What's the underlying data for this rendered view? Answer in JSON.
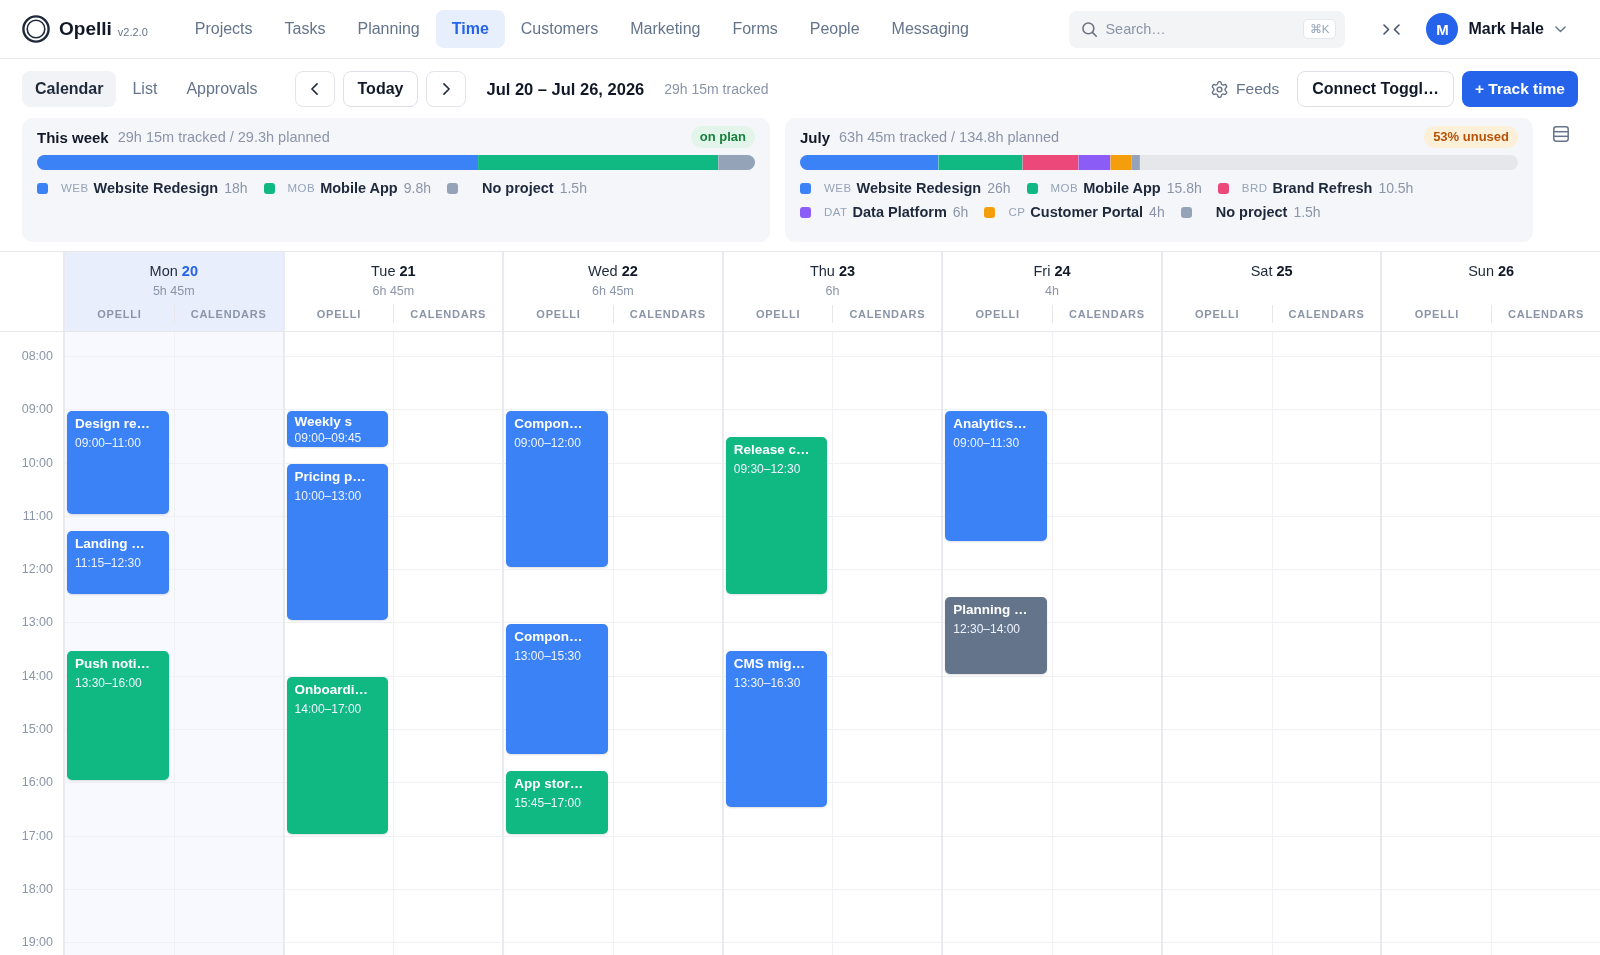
{
  "app": {
    "name": "Opelli",
    "version": "v2.2.0"
  },
  "nav": [
    {
      "label": "Projects",
      "selected": false
    },
    {
      "label": "Tasks",
      "selected": false
    },
    {
      "label": "Planning",
      "selected": false
    },
    {
      "label": "Time",
      "selected": true
    },
    {
      "label": "Customers",
      "selected": false
    },
    {
      "label": "Marketing",
      "selected": false
    },
    {
      "label": "Forms",
      "selected": false
    },
    {
      "label": "People",
      "selected": false
    },
    {
      "label": "Messaging",
      "selected": false
    }
  ],
  "search": {
    "placeholder": "Search…",
    "shortcut": "⌘K"
  },
  "user": {
    "initial": "M",
    "name": "Mark Hale"
  },
  "view_tabs": [
    {
      "label": "Calendar",
      "selected": true
    },
    {
      "label": "List",
      "selected": false
    },
    {
      "label": "Approvals",
      "selected": false
    }
  ],
  "toolbar": {
    "today_button": "Today",
    "date_range": "Jul 20 – Jul 26, 2026",
    "tracked": "29h 15m tracked",
    "feeds_button": "Feeds",
    "connect_button": "Connect Toggl…",
    "track_button": "+ Track time"
  },
  "summaries": [
    {
      "title": "This week",
      "stats": "29h 15m tracked / 29.3h planned",
      "badge": {
        "text": "on plan",
        "kind": "success"
      },
      "projects": [
        {
          "code": "WEB",
          "name": "Website Redesign",
          "hours": "18h",
          "color": "#3b82f6"
        },
        {
          "code": "MOB",
          "name": "Mobile App",
          "hours": "9.8h",
          "color": "#10b981"
        },
        {
          "name": "No project",
          "hours": "1.5h",
          "color": "#94a3b8"
        }
      ]
    },
    {
      "title": "July",
      "stats": "63h 45m tracked / 134.8h planned",
      "badge": {
        "text": "53% unused",
        "kind": "warning"
      },
      "projects": [
        {
          "code": "WEB",
          "name": "Website Redesign",
          "hours": "26h",
          "color": "#3b82f6"
        },
        {
          "code": "MOB",
          "name": "Mobile App",
          "hours": "15.8h",
          "color": "#10b981"
        },
        {
          "code": "BRD",
          "name": "Brand Refresh",
          "hours": "10.5h",
          "color": "#ec4879"
        },
        {
          "code": "DAT",
          "name": "Data Platform",
          "hours": "6h",
          "color": "#8b5cf6"
        },
        {
          "code": "CP",
          "name": "Customer Portal",
          "hours": "4h",
          "color": "#f59e0b"
        },
        {
          "name": "No project",
          "hours": "1.5h",
          "color": "#94a3b8"
        }
      ]
    }
  ],
  "calendar": {
    "hours": [
      "08:00",
      "09:00",
      "10:00",
      "11:00",
      "12:00",
      "13:00",
      "14:00",
      "15:00",
      "16:00",
      "17:00",
      "18:00",
      "19:00"
    ],
    "days": [
      {
        "weekday": "Mon",
        "date": "20",
        "total": "5h 45m",
        "today": true,
        "sources": [
          "OPELLI",
          "CALENDARS"
        ],
        "events": [
          {
            "title": "Design re…",
            "time": "09:00–11:00",
            "color": "#3b82f6"
          },
          {
            "title": "Landing …",
            "time": "11:15–12:30",
            "color": "#3b82f6"
          },
          {
            "title": "Push noti…",
            "time": "13:30–16:00",
            "color": "#10b981"
          }
        ]
      },
      {
        "weekday": "Tue",
        "date": "21",
        "total": "6h 45m",
        "today": false,
        "sources": [
          "OPELLI",
          "CALENDARS"
        ],
        "events": [
          {
            "title": "Weekly s",
            "time": "09:00–09:45",
            "color": "#3b82f6"
          },
          {
            "title": "Pricing p…",
            "time": "10:00–13:00",
            "color": "#3b82f6"
          },
          {
            "title": "Onboardi…",
            "time": "14:00–17:00",
            "color": "#10b981"
          }
        ]
      },
      {
        "weekday": "Wed",
        "date": "22",
        "total": "6h 45m",
        "today": false,
        "sources": [
          "OPELLI",
          "CALENDARS"
        ],
        "events": [
          {
            "title": "Compon…",
            "time": "09:00–12:00",
            "color": "#3b82f6"
          },
          {
            "title": "Compon…",
            "time": "13:00–15:30",
            "color": "#3b82f6"
          },
          {
            "title": "App stor…",
            "time": "15:45–17:00",
            "color": "#10b981"
          }
        ]
      },
      {
        "weekday": "Thu",
        "date": "23",
        "total": "6h",
        "today": false,
        "sources": [
          "OPELLI",
          "CALENDARS"
        ],
        "events": [
          {
            "title": "Release c…",
            "time": "09:30–12:30",
            "color": "#10b981"
          },
          {
            "title": "CMS mig…",
            "time": "13:30–16:30",
            "color": "#3b82f6"
          }
        ]
      },
      {
        "weekday": "Fri",
        "date": "24",
        "total": "4h",
        "today": false,
        "sources": [
          "OPELLI",
          "CALENDARS"
        ],
        "events": [
          {
            "title": "Analytics…",
            "time": "09:00–11:30",
            "color": "#3b82f6"
          },
          {
            "title": "Planning …",
            "time": "12:30–14:00",
            "color": "#64748b"
          }
        ]
      },
      {
        "weekday": "Sat",
        "date": "25",
        "today": false,
        "sources": [
          "OPELLI",
          "CALENDARS"
        ]
      },
      {
        "weekday": "Sun",
        "date": "26",
        "today": false,
        "sources": [
          "OPELLI",
          "CALENDARS"
        ]
      }
    ]
  }
}
